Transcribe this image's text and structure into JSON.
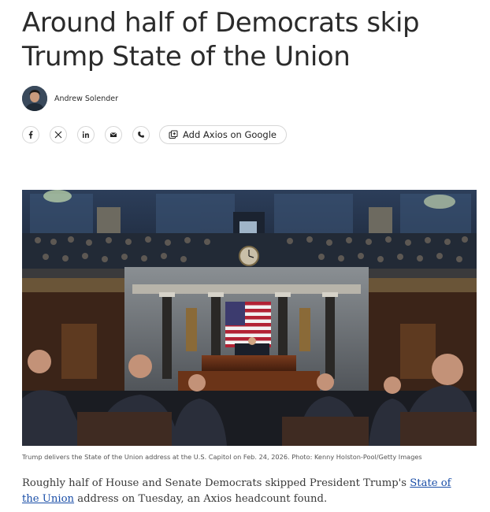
{
  "article": {
    "headline": "Around half of Democrats skip Trump State of the Union",
    "author": "Andrew Solender",
    "share": {
      "buttons": [
        {
          "icon": "facebook-icon",
          "glyph": "f"
        },
        {
          "icon": "x-icon",
          "glyph": "𝕏"
        },
        {
          "icon": "linkedin-icon",
          "glyph": "in"
        },
        {
          "icon": "email-icon",
          "glyph": "✉"
        },
        {
          "icon": "phone-icon",
          "glyph": "✆"
        }
      ],
      "google_label": "Add Axios on Google"
    },
    "image_caption": "Trump delivers the State of the Union address at the U.S. Capitol on Feb. 24, 2026. Photo: Kenny Holston-Pool/Getty Images",
    "body": {
      "text_before": "Roughly half of House and Senate Democrats skipped President Trump's ",
      "link_text": "State of the Union",
      "text_after": " address on Tuesday, an Axios headcount found."
    }
  },
  "colors": {
    "link": "#1b4fa8",
    "text": "#2b2b2b",
    "border": "#d6d6d6"
  }
}
